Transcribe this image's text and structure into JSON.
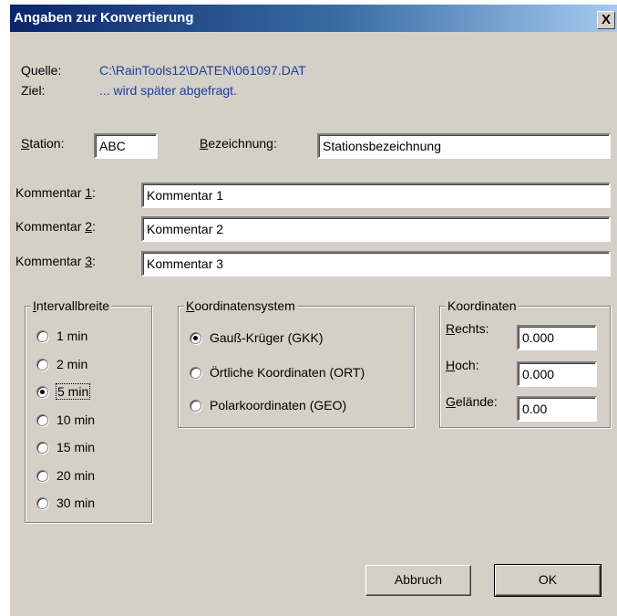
{
  "window": {
    "title": "Angaben zur Konvertierung",
    "close_glyph": "X"
  },
  "source": {
    "label": "Quelle:",
    "value": "C:\\RainTools12\\DATEN\\061097.DAT"
  },
  "target": {
    "label": "Ziel:",
    "value": "... wird später abgefragt."
  },
  "station": {
    "label_key": "S",
    "label_rest": "tation:",
    "value": "ABC"
  },
  "designation": {
    "label_key": "B",
    "label_rest": "ezeichnung:",
    "value": "Stationsbezeichnung"
  },
  "comments": [
    {
      "label_pre": "Kommentar ",
      "label_key": "1",
      "label_post": ":",
      "value": "Kommentar 1"
    },
    {
      "label_pre": "Kommentar ",
      "label_key": "2",
      "label_post": ":",
      "value": "Kommentar 2"
    },
    {
      "label_pre": "Kommentar ",
      "label_key": "3",
      "label_post": ":",
      "value": "Kommentar 3"
    }
  ],
  "interval": {
    "legend_key": "I",
    "legend_rest": "ntervallbreite",
    "options": [
      "1 min",
      "2 min",
      "5 min",
      "10 min",
      "15 min",
      "20 min",
      "30 min"
    ],
    "selected": "5 min"
  },
  "coordsystem": {
    "legend_key": "K",
    "legend_rest": "oordinatensystem",
    "options": [
      "Gauß-Krüger (GKK)",
      "Örtliche Koordinaten (ORT)",
      "Polarkoordinaten (GEO)"
    ],
    "selected": "Gauß-Krüger (GKK)"
  },
  "coordinates": {
    "legend": "Koordinaten",
    "rechts": {
      "label_key": "R",
      "label_rest": "echts:",
      "value": "0.000"
    },
    "hoch": {
      "label_key": "H",
      "label_rest": "och:",
      "value": "0.000"
    },
    "gelaende": {
      "label_key": "G",
      "label_rest": "elände:",
      "value": "0.00"
    }
  },
  "buttons": {
    "cancel": "Abbruch",
    "ok": "OK"
  }
}
